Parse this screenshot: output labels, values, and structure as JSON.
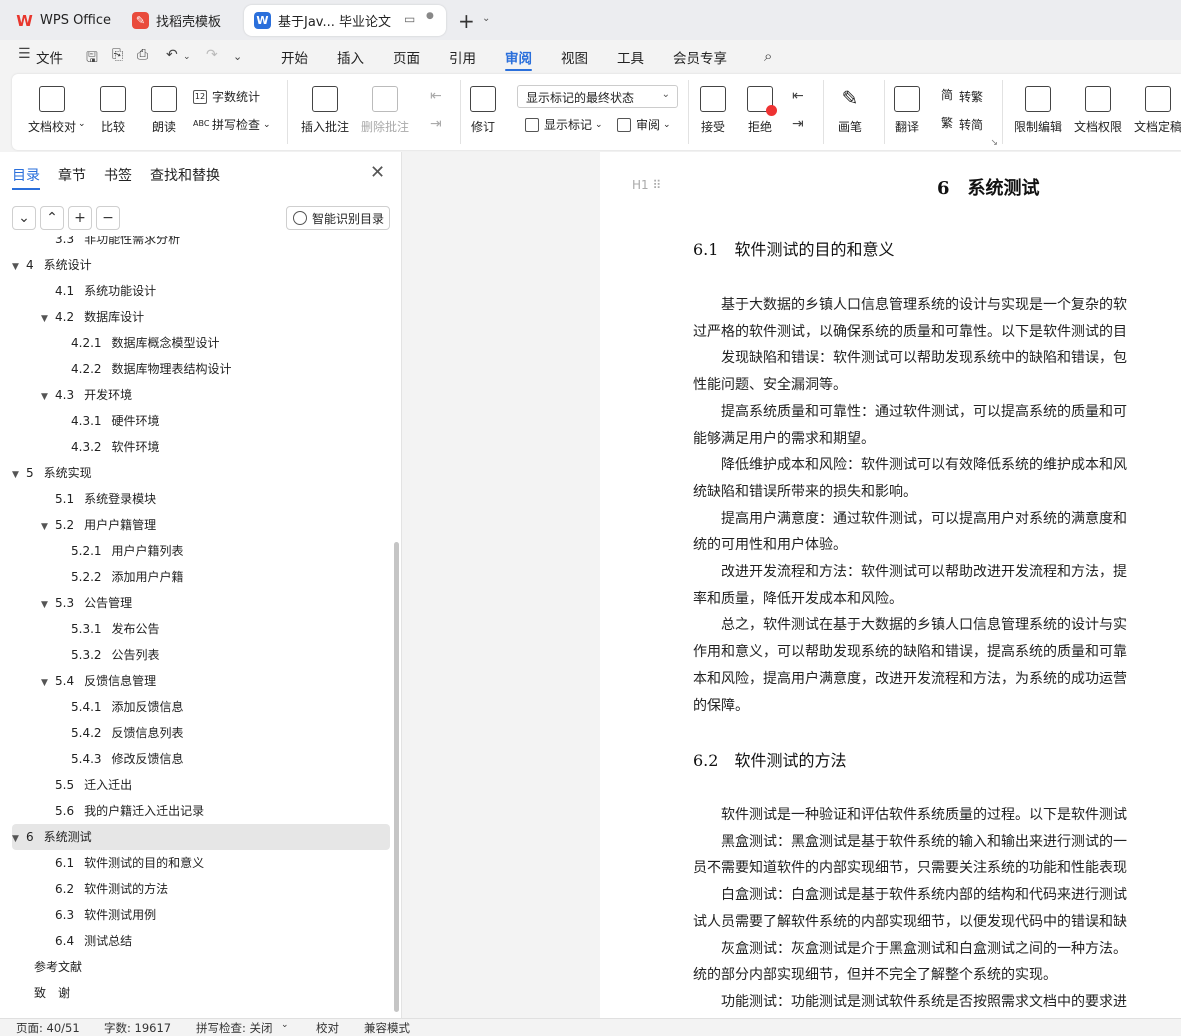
{
  "tabs": [
    {
      "label": "WPS Office",
      "icon": "wps-logo-icon",
      "color": "#e8362d"
    },
    {
      "label": "找稻壳模板",
      "icon": "docer-icon",
      "color": "#e94b3c"
    },
    {
      "label": "基于Jav... 毕业论文",
      "icon": "word-doc-icon",
      "color": "#2a6fdb"
    }
  ],
  "newtab": "+",
  "menu": {
    "file": "文件",
    "items": [
      "开始",
      "插入",
      "页面",
      "引用",
      "审阅",
      "视图",
      "工具",
      "会员专享"
    ],
    "active": "审阅"
  },
  "ribbon": {
    "check_doc": "文档校对",
    "compare": "比较",
    "read_aloud": "朗读",
    "word_count": "字数统计",
    "spell_check": "拼写检查",
    "insert_comment": "插入批注",
    "delete_comment": "删除批注",
    "track": "修订",
    "markup_dropdown": "显示标记的最终状态",
    "show_markup": "显示标记",
    "review": "审阅",
    "accept": "接受",
    "reject": "拒绝",
    "pen": "画笔",
    "translate": "翻译",
    "to_traditional": "转繁",
    "to_simplified": "转简",
    "restrict_edit": "限制编辑",
    "doc_permission": "文档权限",
    "doc_final": "文档定稿"
  },
  "sidebar": {
    "tabs": [
      "目录",
      "章节",
      "书签",
      "查找和替换"
    ],
    "smart_toc": "智能识别目录",
    "toc": [
      {
        "num": "3.3",
        "text": "非功能性需求分析",
        "level": 2
      },
      {
        "num": "4",
        "text": "系统设计",
        "level": 1,
        "expanded": true
      },
      {
        "num": "4.1",
        "text": "系统功能设计",
        "level": 2
      },
      {
        "num": "4.2",
        "text": "数据库设计",
        "level": 2,
        "expanded": true
      },
      {
        "num": "4.2.1",
        "text": "数据库概念模型设计",
        "level": 3
      },
      {
        "num": "4.2.2",
        "text": "数据库物理表结构设计",
        "level": 3
      },
      {
        "num": "4.3",
        "text": "开发环境",
        "level": 2,
        "expanded": true
      },
      {
        "num": "4.3.1",
        "text": "硬件环境",
        "level": 3
      },
      {
        "num": "4.3.2",
        "text": "软件环境",
        "level": 3
      },
      {
        "num": "5",
        "text": "系统实现",
        "level": 1,
        "expanded": true
      },
      {
        "num": "5.1",
        "text": "系统登录模块",
        "level": 2
      },
      {
        "num": "5.2",
        "text": "用户户籍管理",
        "level": 2,
        "expanded": true
      },
      {
        "num": "5.2.1",
        "text": "用户户籍列表",
        "level": 3
      },
      {
        "num": "5.2.2",
        "text": "添加用户户籍",
        "level": 3
      },
      {
        "num": "5.3",
        "text": "公告管理",
        "level": 2,
        "expanded": true
      },
      {
        "num": "5.3.1",
        "text": "发布公告",
        "level": 3
      },
      {
        "num": "5.3.2",
        "text": "公告列表",
        "level": 3
      },
      {
        "num": "5.4",
        "text": "反馈信息管理",
        "level": 2,
        "expanded": true
      },
      {
        "num": "5.4.1",
        "text": "添加反馈信息",
        "level": 3
      },
      {
        "num": "5.4.2",
        "text": "反馈信息列表",
        "level": 3
      },
      {
        "num": "5.4.3",
        "text": "修改反馈信息",
        "level": 3
      },
      {
        "num": "5.5",
        "text": "迁入迁出",
        "level": 2
      },
      {
        "num": "5.6",
        "text": "我的户籍迁入迁出记录",
        "level": 2
      },
      {
        "num": "6",
        "text": "系统测试",
        "level": 1,
        "expanded": true,
        "selected": true
      },
      {
        "num": "6.1",
        "text": "软件测试的目的和意义",
        "level": 2
      },
      {
        "num": "6.2",
        "text": "软件测试的方法",
        "level": 2
      },
      {
        "num": "6.3",
        "text": "软件测试用例",
        "level": 2
      },
      {
        "num": "6.4",
        "text": "测试总结",
        "level": 2
      },
      {
        "num": "",
        "text": "参考文献",
        "level": 1
      },
      {
        "num": "",
        "text": "致　谢",
        "level": 1
      }
    ]
  },
  "document": {
    "chapter_title": "6　系统测试",
    "heading_marker": "H1",
    "section1_title": "6.1　软件测试的目的和意义",
    "section1_lines": [
      "　　基于大数据的乡镇人口信息管理系统的设计与实现是一个复杂的软",
      "过严格的软件测试，以确保系统的质量和可靠性。以下是软件测试的目",
      "　　发现缺陷和错误：软件测试可以帮助发现系统中的缺陷和错误，包",
      "性能问题、安全漏洞等。",
      "　　提高系统质量和可靠性：通过软件测试，可以提高系统的质量和可",
      "能够满足用户的需求和期望。",
      "　　降低维护成本和风险：软件测试可以有效降低系统的维护成本和风",
      "统缺陷和错误所带来的损失和影响。",
      "　　提高用户满意度：通过软件测试，可以提高用户对系统的满意度和",
      "统的可用性和用户体验。",
      "　　改进开发流程和方法：软件测试可以帮助改进开发流程和方法，提",
      "率和质量，降低开发成本和风险。",
      "　　总之，软件测试在基于大数据的乡镇人口信息管理系统的设计与实",
      "作用和意义，可以帮助发现系统的缺陷和错误，提高系统的质量和可靠",
      "本和风险，提高用户满意度，改进开发流程和方法，为系统的成功运营",
      "的保障。"
    ],
    "section2_title": "6.2　软件测试的方法",
    "section2_lines": [
      "　　软件测试是一种验证和评估软件系统质量的过程。以下是软件测试",
      "　　黑盒测试：黑盒测试是基于软件系统的输入和输出来进行测试的一",
      "员不需要知道软件的内部实现细节，只需要关注系统的功能和性能表现",
      "　　白盒测试：白盒测试是基于软件系统内部的结构和代码来进行测试",
      "试人员需要了解软件系统的内部实现细节，以便发现代码中的错误和缺",
      "　　灰盒测试：灰盒测试是介于黑盒测试和白盒测试之间的一种方法。",
      "统的部分内部实现细节，但并不完全了解整个系统的实现。",
      "　　功能测试：功能测试是测试软件系统是否按照需求文档中的要求进"
    ]
  },
  "status": {
    "page": "页面: 40/51",
    "words": "字数: 19617",
    "spell": "拼写检查: 关闭",
    "proof": "校对",
    "compat": "兼容模式"
  }
}
